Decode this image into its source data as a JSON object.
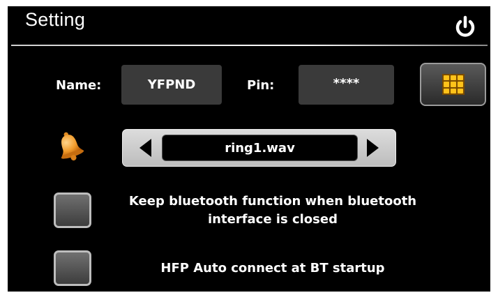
{
  "header": {
    "title": "Setting",
    "power_icon": "power-icon"
  },
  "device": {
    "name_label": "Name:",
    "name_value": "YFPND",
    "pin_label": "Pin:",
    "pin_value": "****",
    "keypad_icon": "keypad-grid-icon"
  },
  "ringtone": {
    "bell_icon": "bell-icon",
    "value": "ring1.wav",
    "prev_icon": "left-arrow-icon",
    "next_icon": "right-arrow-icon"
  },
  "options": {
    "keep_bt": {
      "line1": "Keep bluetooth function when bluetooth",
      "line2": "interface is closed",
      "checked": false
    },
    "hfp_auto": {
      "label": "HFP Auto connect at BT startup",
      "checked": false
    }
  },
  "colors": {
    "background": "#000000",
    "text": "#ffffff",
    "accent": "#ffc21a"
  }
}
